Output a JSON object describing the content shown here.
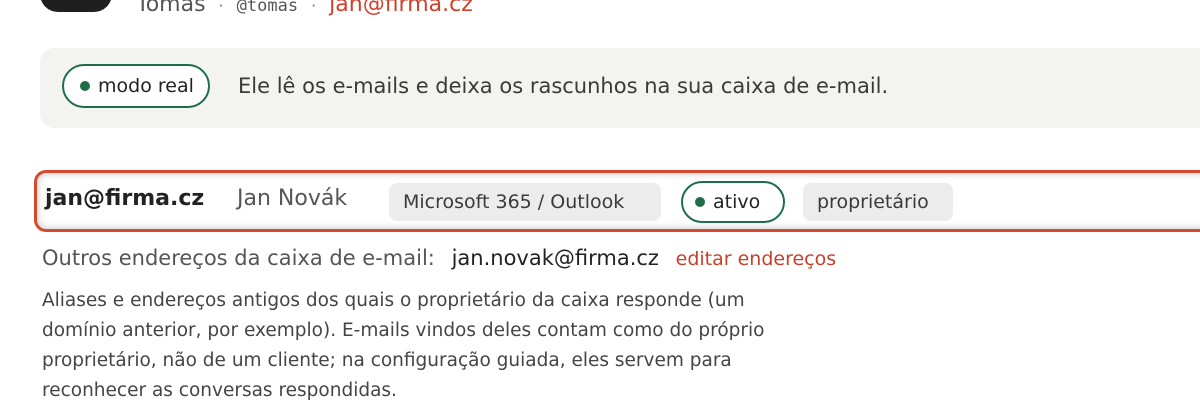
{
  "user": {
    "name": "Tomas",
    "handle": "@tomas",
    "email": "jan@firma.cz",
    "separator": "·"
  },
  "mode_notice": {
    "pill_label": "modo real",
    "text": "Ele lê os e-mails e deixa os rascunhos na sua caixa de e-mail."
  },
  "account": {
    "email": "jan@firma.cz",
    "owner_name": "Jan Novák",
    "provider": "Microsoft 365 / Outlook",
    "status": "ativo",
    "role": "proprietário"
  },
  "other_addresses": {
    "label": "Outros endereços da caixa de e-mail:",
    "value": "jan.novak@firma.cz",
    "edit_link": "editar endereços",
    "description": "Aliases e endereços antigos dos quais o proprietário da caixa responde (um domínio anterior, por exemplo). E-mails vindos deles contam como do próprio proprietário, não de um cliente; na configuração guiada, eles servem para reconhecer as conversas respondidas."
  },
  "colors": {
    "accent_red": "#d44a2a",
    "status_green": "#1f6e4a",
    "link_red": "#c8402a"
  }
}
